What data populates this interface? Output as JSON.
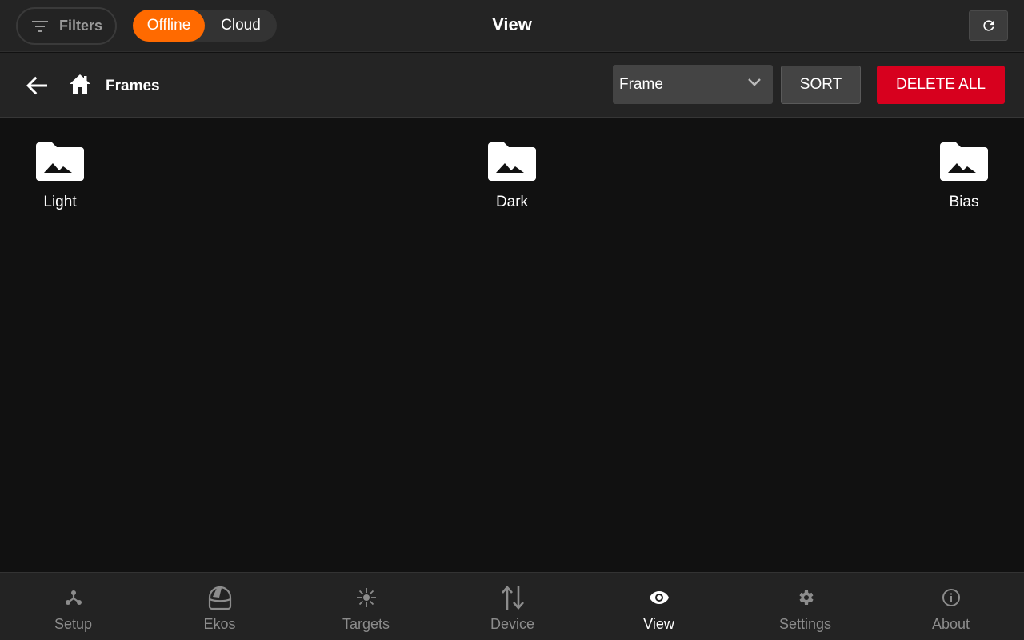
{
  "header": {
    "filters_label": "Filters",
    "toggle": {
      "offline_label": "Offline",
      "cloud_label": "Cloud",
      "selected": "Offline"
    },
    "title": "View"
  },
  "toolbar": {
    "breadcrumb": "Frames",
    "sort_select_value": "Frame",
    "sort_label": "SORT",
    "delete_all_label": "DELETE ALL"
  },
  "folders": [
    {
      "label": "Light",
      "icon": "image-folder-icon"
    },
    {
      "label": "Dark",
      "icon": "image-folder-icon"
    },
    {
      "label": "Bias",
      "icon": "image-folder-icon"
    }
  ],
  "nav": {
    "items": [
      {
        "label": "Setup",
        "icon": "setup-icon"
      },
      {
        "label": "Ekos",
        "icon": "ekos-icon"
      },
      {
        "label": "Targets",
        "icon": "targets-icon"
      },
      {
        "label": "Device",
        "icon": "device-icon"
      },
      {
        "label": "View",
        "icon": "view-icon",
        "active": true
      },
      {
        "label": "Settings",
        "icon": "settings-icon"
      },
      {
        "label": "About",
        "icon": "about-icon"
      }
    ]
  },
  "colors": {
    "accent": "#ff6a00",
    "danger": "#d7001e",
    "background": "#111111",
    "bar": "#242424"
  }
}
